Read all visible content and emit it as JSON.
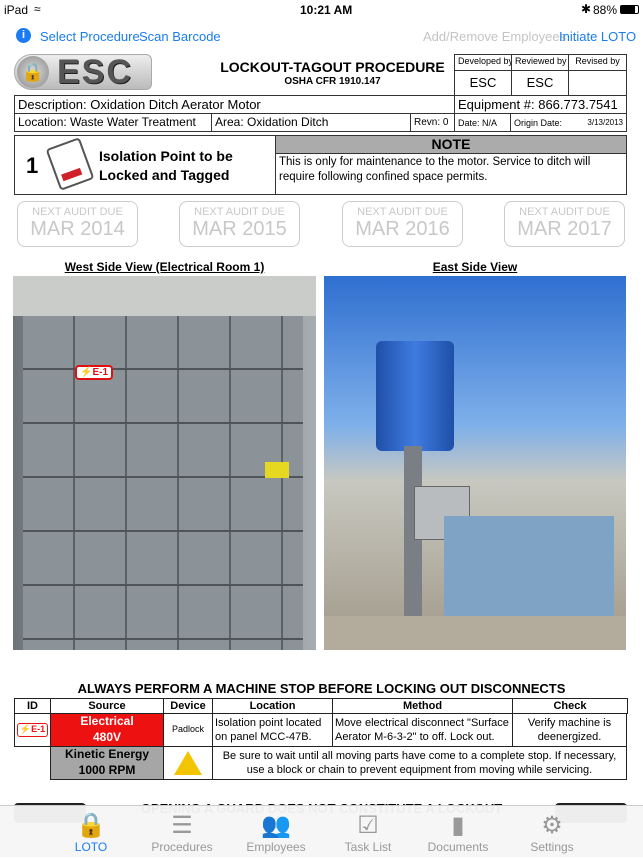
{
  "status_bar": {
    "device": "iPad",
    "time": "10:21 AM",
    "battery": "88%"
  },
  "nav": {
    "select_procedure": "Select Procedure",
    "scan_barcode": "Scan Barcode",
    "add_remove_employees": "Add/Remove Employees",
    "initiate_loto": "Initiate LOTO"
  },
  "header": {
    "logo": "ESC",
    "title": "LOCKOUT-TAGOUT PROCEDURE",
    "subtitle": "OSHA CFR 1910.147",
    "developed_by_label": "Developed by",
    "reviewed_by_label": "Reviewed by",
    "revised_by_label": "Revised by",
    "developed_by": "ESC",
    "reviewed_by": "ESC",
    "revised_by": ""
  },
  "info": {
    "description": "Description: Oxidation Ditch Aerator Motor",
    "equipment": "Equipment #: 866.773.7541",
    "location": "Location:  Waste Water Treatment",
    "area": "Area: Oxidation Ditch",
    "revn": "Revn: 0",
    "date": "Date: N/A",
    "origin_date_label": "Origin Date:",
    "origin_date": "3/13/2013"
  },
  "isolation": {
    "count": "1",
    "label_line1": "Isolation Point to be",
    "label_line2": "Locked and Tagged"
  },
  "note": {
    "title": "NOTE",
    "text": "This is only for maintenance to the motor.  Service to ditch will require following confined space permits."
  },
  "audits": [
    {
      "label": "NEXT AUDIT DUE",
      "date": "MAR 2014"
    },
    {
      "label": "NEXT AUDIT DUE",
      "date": "MAR 2015"
    },
    {
      "label": "NEXT AUDIT DUE",
      "date": "MAR 2016"
    },
    {
      "label": "NEXT AUDIT DUE",
      "date": "MAR 2017"
    }
  ],
  "photos": {
    "west_title": "West Side View (Electrical Room 1)",
    "east_title": "East Side View",
    "west_tag": "E-1"
  },
  "warning": "ALWAYS PERFORM A MACHINE STOP BEFORE LOCKING OUT DISCONNECTS",
  "table": {
    "headers": [
      "ID",
      "Source",
      "Device",
      "Location",
      "Method",
      "Check"
    ],
    "row1": {
      "id": "E-1",
      "source_line1": "Electrical",
      "source_line2": "480V",
      "device": "Padlock",
      "location": "Isolation point located on panel MCC-47B.",
      "method": "Move electrical disconnect \"Surface Aerator M-6-3-2\" to off. Lock out.",
      "check": "Verify machine is deenergized."
    },
    "row2": {
      "source_line1": "Kinetic Energy",
      "source_line2": "1000 RPM",
      "note": "Be sure to wait until all moving parts have come to a complete stop.  If necessary, use a block or chain to prevent equipment from moving while servicing."
    }
  },
  "guard_warning": "OPENING A GUARD DOES NOT CONSTITUTE A LOCKOUT",
  "colors": {
    "accent": "#1a7cf0",
    "electrical": "#ee1111",
    "kinetic": "#a6a6a6"
  },
  "tabs": [
    {
      "label": "LOTO",
      "icon": "lock-icon",
      "active": true
    },
    {
      "label": "Procedures",
      "icon": "notepad-icon"
    },
    {
      "label": "Employees",
      "icon": "people-icon"
    },
    {
      "label": "Task List",
      "icon": "checkbox-icon"
    },
    {
      "label": "Documents",
      "icon": "book-icon"
    },
    {
      "label": "Settings",
      "icon": "gear-icon"
    }
  ]
}
